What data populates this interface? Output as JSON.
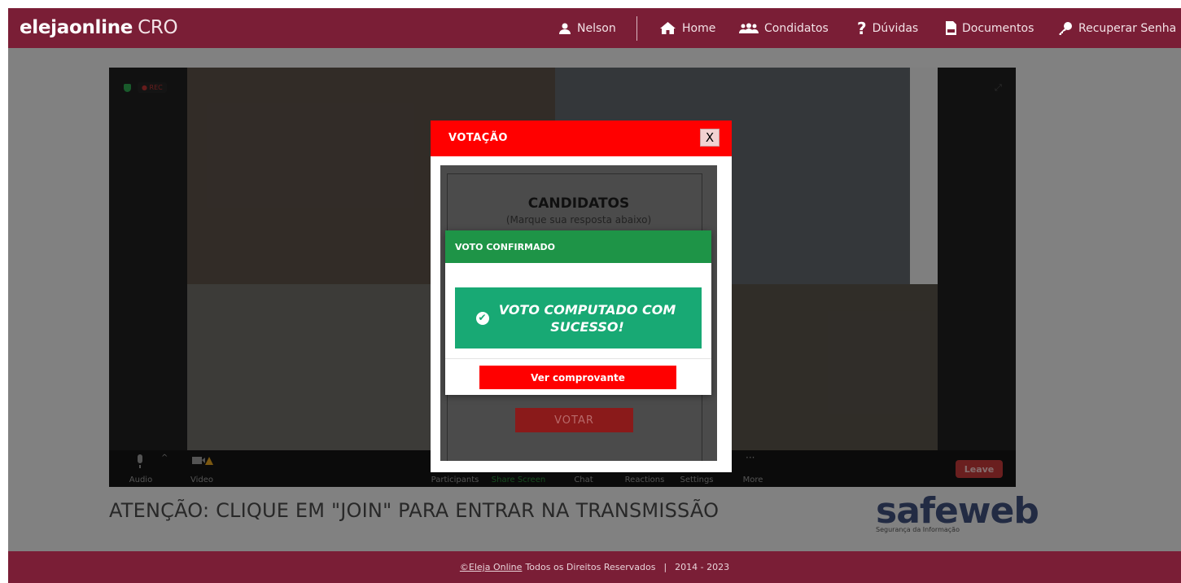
{
  "brand": {
    "name": "elejaonline",
    "suffix": "CRO"
  },
  "nav": {
    "user": "Nelson",
    "home": "Home",
    "candidates": "Condidatos",
    "questions": "Dúvidas",
    "documents": "Documentos",
    "recover": "Recuperar Senha"
  },
  "zoom": {
    "rec_label": "REC",
    "toolbar": {
      "audio": "Audio",
      "video": "Video",
      "participants": "Participants",
      "share_screen": "Share Screen",
      "chat": "Chat",
      "reactions": "Reactions",
      "settings": "Settings",
      "more": "More",
      "leave": "Leave"
    }
  },
  "attention_text": "ATENÇÃO: CLIQUE EM \"JOIN\" PARA ENTRAR NA TRANSMISSÃO",
  "sponsor": {
    "logo": "safeweb",
    "tagline": "Segurança da Informação"
  },
  "footer": {
    "link": "©Eleja Online",
    "text": "Todos os Direitos Reservados",
    "separator": "|",
    "years": "2014 - 2023"
  },
  "modal": {
    "title": "VOTAÇÃO",
    "close_label": "X",
    "candidates_title": "CANDIDATOS",
    "candidates_subtitle": "(Marque sua resposta abaixo)",
    "vote_button": "VOTAR"
  },
  "confirm": {
    "title": "VOTO CONFIRMADO",
    "message": "VOTO COMPUTADO COM SUCESSO!",
    "receipt_button": "Ver comprovante"
  },
  "colors": {
    "header": "#7a1e36",
    "modal_header": "#ff0000",
    "confirm_header": "#1e9447",
    "success": "#18a974"
  }
}
